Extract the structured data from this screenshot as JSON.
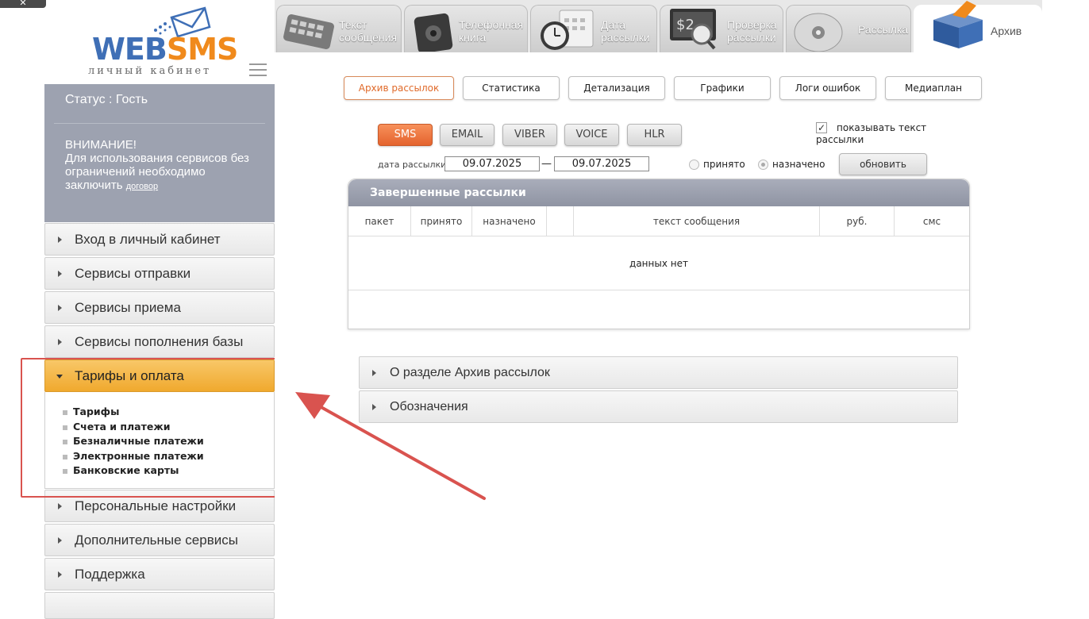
{
  "logo": {
    "web": "WEB",
    "sms": "SMS",
    "sub": "личный кабинет"
  },
  "status": {
    "line": "Статус : Гость",
    "warn_title": "ВНИМАНИЕ!",
    "warn_text": "Для использования сервисов без ограничений необходимо заключить",
    "warn_link": "договор"
  },
  "sidebar": {
    "items": [
      {
        "label": "Вход в личный кабинет"
      },
      {
        "label": "Сервисы отправки"
      },
      {
        "label": "Сервисы приема"
      },
      {
        "label": "Сервисы пополнения базы"
      },
      {
        "label": "Тарифы и оплата"
      },
      {
        "label": "Персональные настройки"
      },
      {
        "label": "Дополнительные сервисы"
      },
      {
        "label": "Поддержка"
      }
    ],
    "submenu": [
      {
        "label": "Тарифы"
      },
      {
        "label": "Счета и платежи"
      },
      {
        "label": "Безналичные платежи"
      },
      {
        "label": "Электронные платежи"
      },
      {
        "label": "Банковские карты"
      }
    ]
  },
  "tabs": [
    {
      "line1": "Текст",
      "line2": "сообщения"
    },
    {
      "line1": "Телефонная",
      "line2": "книга"
    },
    {
      "line1": "Дата",
      "line2": "рассылки"
    },
    {
      "line1": "Проверка",
      "line2": "рассылки"
    },
    {
      "line1": "Рассылка",
      "line2": ""
    },
    {
      "line1": "Архив",
      "line2": ""
    }
  ],
  "subnav": [
    {
      "label": "Архив рассылок"
    },
    {
      "label": "Статистика"
    },
    {
      "label": "Детализация"
    },
    {
      "label": "Графики"
    },
    {
      "label": "Логи ошибок"
    },
    {
      "label": "Медиаплан"
    }
  ],
  "channels": [
    "SMS",
    "EMAIL",
    "VIBER",
    "VOICE",
    "HLR"
  ],
  "filters": {
    "show_text_label": "показывать текст рассылки",
    "date_label": "дата рассылки",
    "date_from": "09.07.2025",
    "date_to": "09.07.2025",
    "dash": "—",
    "radio_accepted": "принято",
    "radio_assigned": "назначено",
    "refresh": "обновить"
  },
  "panel": {
    "title": "Завершенные рассылки",
    "columns": [
      "пакет",
      "принято",
      "назначено",
      "",
      "текст сообщения",
      "руб.",
      "смс"
    ],
    "empty": "данных нет"
  },
  "accordion": [
    {
      "label": "О разделе Архив рассылок"
    },
    {
      "label": "Обозначения"
    }
  ],
  "colors": {
    "accent": "#f0a92e",
    "brand_blue": "#3f6fb6",
    "brand_orange": "#f08a1c",
    "annotation_red": "#d9534f",
    "sms_active": "#e4632e"
  }
}
